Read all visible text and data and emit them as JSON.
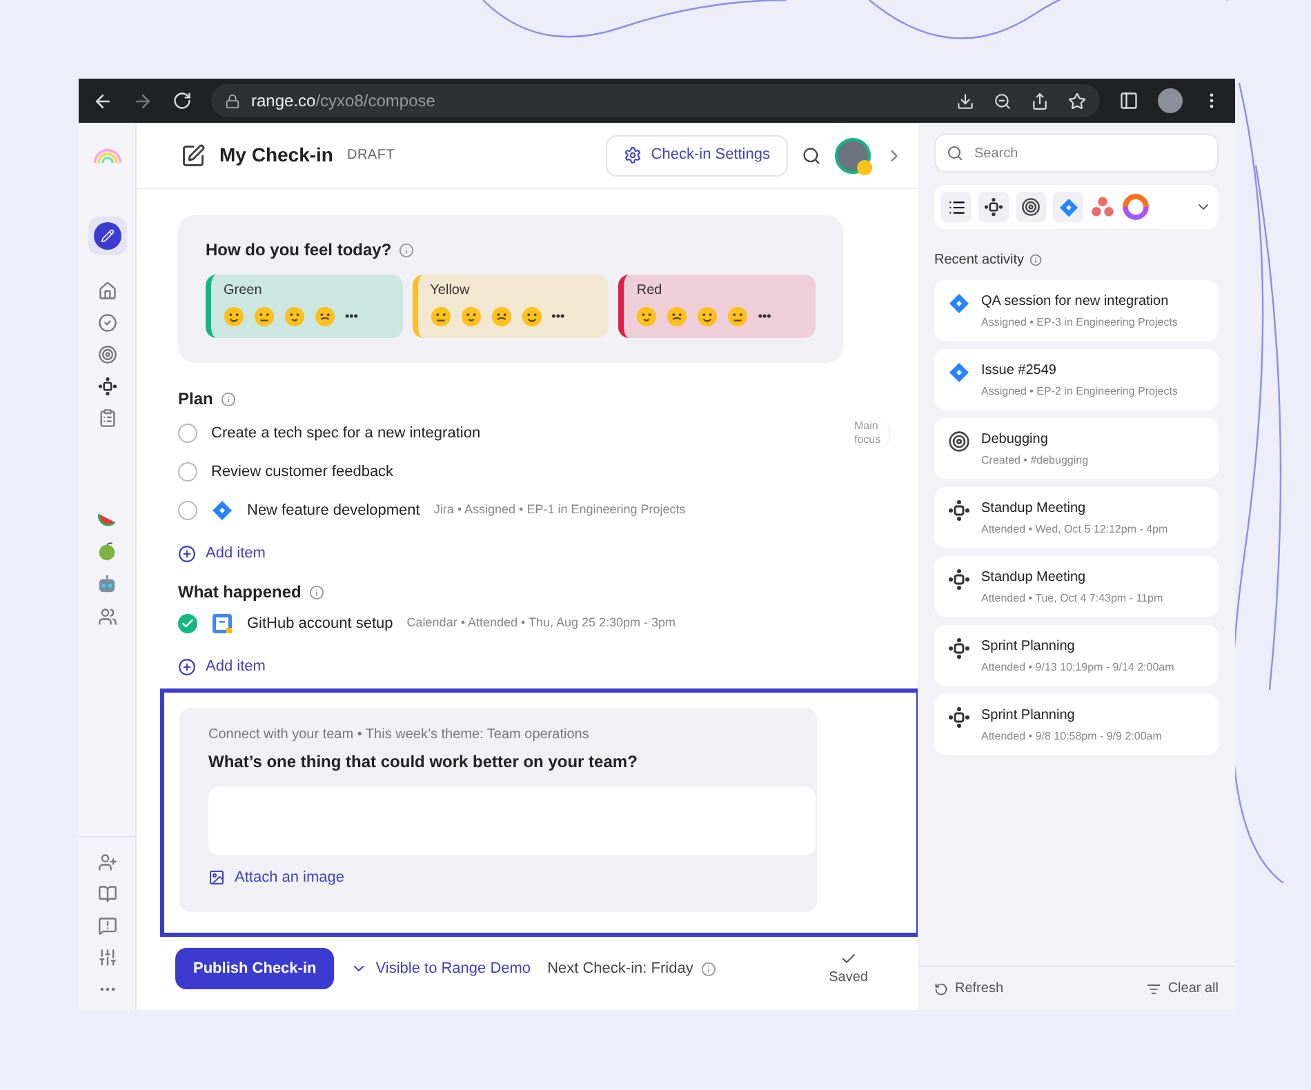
{
  "browser": {
    "host": "range.co",
    "path": "/cyxo8/compose"
  },
  "header": {
    "title": "My Check-in",
    "status": "DRAFT",
    "settings_button": "Check-in Settings"
  },
  "mood": {
    "question": "How do you feel today?",
    "more": "•••",
    "options": [
      {
        "label": "Green",
        "color": "#10b981"
      },
      {
        "label": "Yellow",
        "color": "#fbbf24"
      },
      {
        "label": "Red",
        "color": "#e11d48"
      }
    ]
  },
  "plan": {
    "title": "Plan",
    "main_focus": "Main focus",
    "add_label": "Add item",
    "items": [
      {
        "kind": "plain",
        "text": "Create a tech spec for a new integration",
        "checked": false
      },
      {
        "kind": "plain",
        "text": "Review customer feedback",
        "checked": false
      },
      {
        "kind": "jira",
        "text": "New feature development",
        "meta": "Jira • Assigned • EP-1 in Engineering Projects",
        "checked": false
      }
    ]
  },
  "what_happened": {
    "title": "What happened",
    "add_label": "Add item",
    "items": [
      {
        "kind": "calendar",
        "text": "GitHub account setup",
        "meta": "Calendar • Attended • Thu, Aug 25 2:30pm - 3pm",
        "checked": true
      }
    ]
  },
  "prompt": {
    "context": "Connect with your team • This week’s theme: Team operations",
    "question": "What’s one thing that could work better on your team?",
    "attach_label": "Attach an image"
  },
  "footer": {
    "publish": "Publish Check-in",
    "visibility": "Visible to Range Demo",
    "next_checkin": "Next Check-in: Friday",
    "saved": "Saved"
  },
  "sidebar": {
    "search_placeholder": "Search",
    "recent_title": "Recent activity",
    "refresh": "Refresh",
    "clear_all": "Clear all",
    "activity": [
      {
        "kind": "jira",
        "title": "QA session for new integration",
        "subtitle": "Assigned • EP-3 in Engineering Projects"
      },
      {
        "kind": "jira",
        "title": "Issue #2549",
        "subtitle": "Assigned • EP-2 in Engineering Projects"
      },
      {
        "kind": "goal",
        "title": "Debugging",
        "subtitle": "Created • #debugging"
      },
      {
        "kind": "meeting",
        "title": "Standup Meeting",
        "subtitle": "Attended • Wed, Oct 5 12:12pm - 4pm"
      },
      {
        "kind": "meeting",
        "title": "Standup Meeting",
        "subtitle": "Attended • Tue, Oct 4 7:43pm - 11pm"
      },
      {
        "kind": "meeting",
        "title": "Sprint Planning",
        "subtitle": "Attended • 9/13 10:19pm - 9/14 2:00am"
      },
      {
        "kind": "meeting",
        "title": "Sprint Planning",
        "subtitle": "Attended • 9/8 10:58pm - 9/9 2:00am"
      }
    ]
  }
}
